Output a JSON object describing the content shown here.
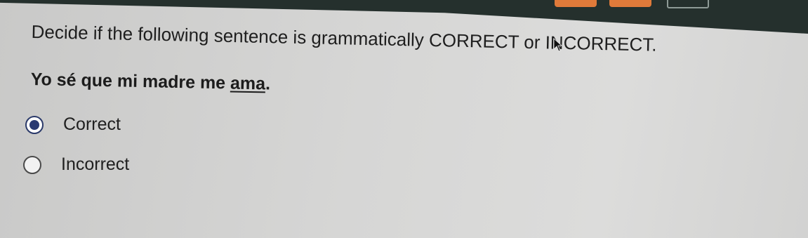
{
  "question": {
    "prompt": "Decide if the following sentence is grammatically CORRECT or INCORRECT.",
    "sentence_before": "Yo sé que mi madre me ",
    "sentence_underlined": "ama",
    "sentence_after": "."
  },
  "options": [
    {
      "label": "Correct",
      "selected": true
    },
    {
      "label": "Incorrect",
      "selected": false
    }
  ],
  "colors": {
    "top_bar": "#25302d",
    "accent_tab": "#e07a3a",
    "radio_selected": "#2a3a72"
  },
  "icons": {
    "cursor": "mouse-pointer-icon"
  }
}
